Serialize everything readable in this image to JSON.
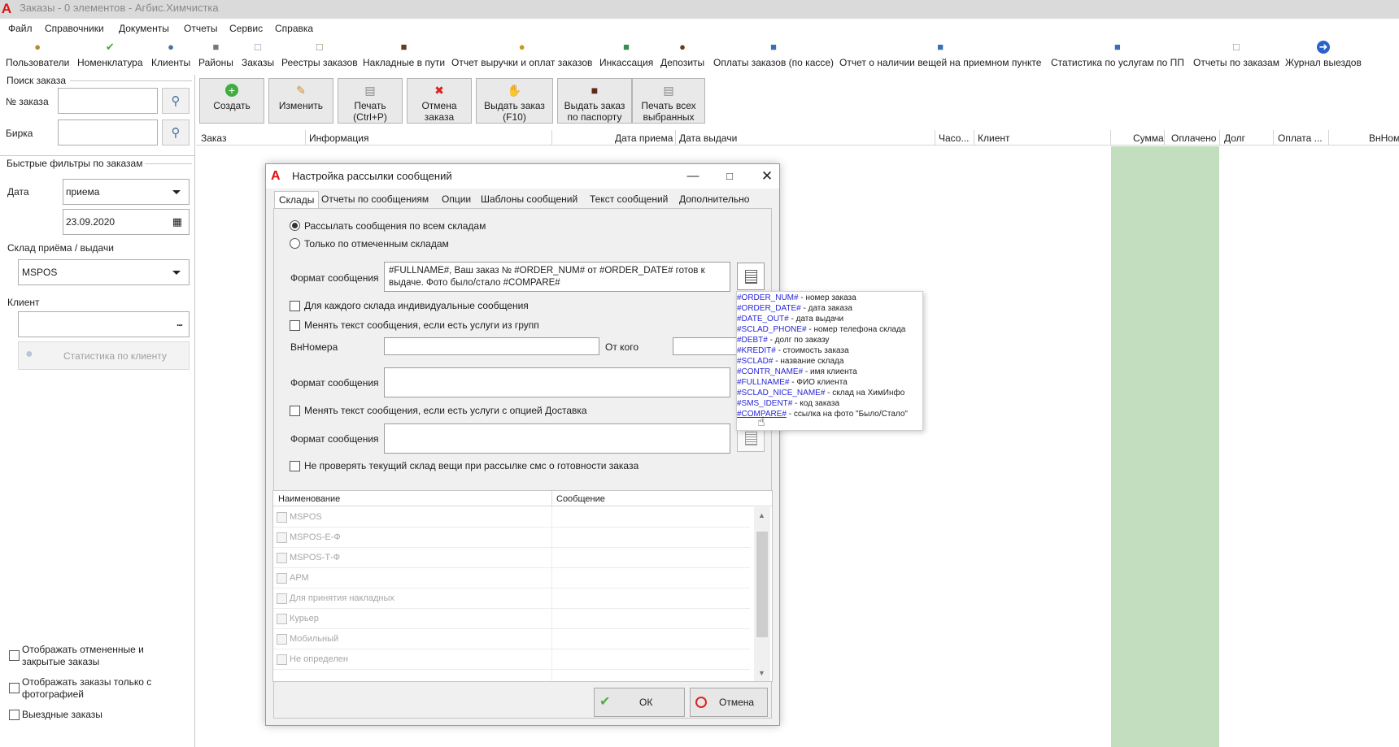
{
  "window": {
    "title": "Заказы - 0 элементов - Агбис.Химчистка"
  },
  "menu": [
    "Файл",
    "Справочники",
    "Документы",
    "Отчеты",
    "Сервис",
    "Справка"
  ],
  "toolbar": [
    "Пользователи",
    "Номенклатура",
    "Клиенты",
    "Районы",
    "Заказы",
    "Реестры заказов",
    "Накладные в пути",
    "Отчет выручки и оплат заказов",
    "Инкассация",
    "Депозиты",
    "Оплаты заказов (по кассе)",
    "Отчет о наличии вещей на приемном пункте",
    "Статистика по услугам по ПП",
    "Отчеты по заказам",
    "Журнал выездов"
  ],
  "search": {
    "title": "Поиск заказа",
    "order_label": "№ заказа",
    "tag_label": "Бирка"
  },
  "filters": {
    "title": "Быстрые фильтры по заказам",
    "date_label": "Дата",
    "date_type": "приема",
    "date_value": "23.09.2020",
    "warehouse_label": "Склад приёма / выдачи",
    "warehouse_value": "MSPOS",
    "client_label": "Клиент",
    "client_stats": "Статистика по клиенту",
    "options": [
      "Отображать отмененные и закрытые заказы",
      "Отображать заказы только с фотографией",
      "Выездные заказы"
    ]
  },
  "actions": {
    "create": "Создать",
    "edit": "Изменить",
    "print": "Печать (Ctrl+P)",
    "cancel": "Отмена заказа",
    "issue": "Выдать заказ (F10)",
    "issue_passport": "Выдать заказ по паспорту",
    "print_all": "Печать всех выбранных"
  },
  "grid": {
    "columns": [
      "Заказ",
      "Информация",
      "Дата приема",
      "Дата выдачи",
      "Часо...",
      "Клиент",
      "Сумма",
      "Оплачено",
      "Долг",
      "Оплата ...",
      "ВнНоме"
    ]
  },
  "dialog": {
    "title": "Настройка рассылки сообщений",
    "tabs": [
      "Склады",
      "Отчеты по сообщениям",
      "Опции",
      "Шаблоны сообщений",
      "Текст сообщений",
      "Дополнительно"
    ],
    "radio_all": "Рассылать сообщения по всем складам",
    "radio_marked": "Только по отмеченным складам",
    "format_label": "Формат сообщения",
    "format_value": "#FULLNAME#, Ваш заказ № #ORDER_NUM# от #ORDER_DATE# готов к выдаче. Фото было/стало #COMPARE#",
    "individual": "Для каждого склада индивидуальные сообщения",
    "change_groups": "Менять текст сообщения, если есть услуги из групп",
    "vn_label": "ВнНомера",
    "from_label": "От кого",
    "format_label2": "Формат сообщения",
    "change_delivery": "Менять текст сообщения, если есть услуги с опцией Доставка",
    "format_label3": "Формат сообщения",
    "no_check": "Не проверять текущий склад вещи при рассылке смс о готовности заказа",
    "list_header": [
      "Наименование",
      "Сообщение"
    ],
    "list_items": [
      "MSPOS",
      "MSPOS-Е-Ф",
      "MSPOS-Т-Ф",
      "АРМ",
      "Для принятия накладных",
      "Курьер",
      "Мобильный",
      "Не определен"
    ],
    "ok": "ОК",
    "cancel": "Отмена"
  },
  "popup": [
    {
      "token": "#ORDER_NUM#",
      "desc": " - номер заказа"
    },
    {
      "token": "#ORDER_DATE#",
      "desc": " - дата заказа"
    },
    {
      "token": "#DATE_OUT#",
      "desc": " - дата выдачи"
    },
    {
      "token": "#SCLAD_PHONE#",
      "desc": " - номер телефона склада"
    },
    {
      "token": "#DEBT#",
      "desc": " - долг по заказу"
    },
    {
      "token": "#KREDIT#",
      "desc": " - стоимость заказа"
    },
    {
      "token": "#SCLAD#",
      "desc": " - название склада"
    },
    {
      "token": "#CONTR_NAME#",
      "desc": " - имя клиента"
    },
    {
      "token": "#FULLNAME#",
      "desc": " - ФИО клиента"
    },
    {
      "token": "#SCLAD_NICE_NAME#",
      "desc": " - склад на ХимИнфо"
    },
    {
      "token": "#SMS_IDENT#",
      "desc": " - код заказа"
    },
    {
      "token": "#COMPARE#",
      "desc": " - ссылка на фото \"Было/Стало\""
    }
  ]
}
